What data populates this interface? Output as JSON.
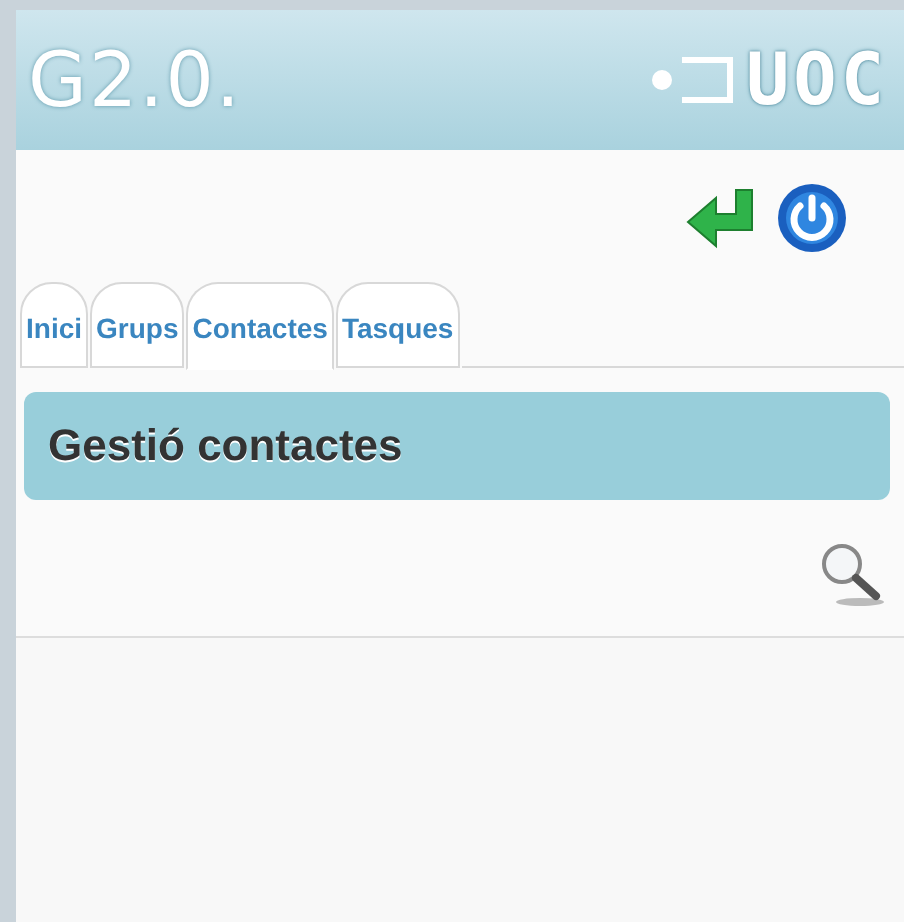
{
  "header": {
    "logo": "G2.0.",
    "brand": "UOC"
  },
  "tabs": [
    {
      "label": "Inici",
      "selected": false
    },
    {
      "label": "Grups",
      "selected": false
    },
    {
      "label": "Contactes",
      "selected": true
    },
    {
      "label": "Tasques",
      "selected": false
    }
  ],
  "section": {
    "title": "Gestió contactes"
  }
}
